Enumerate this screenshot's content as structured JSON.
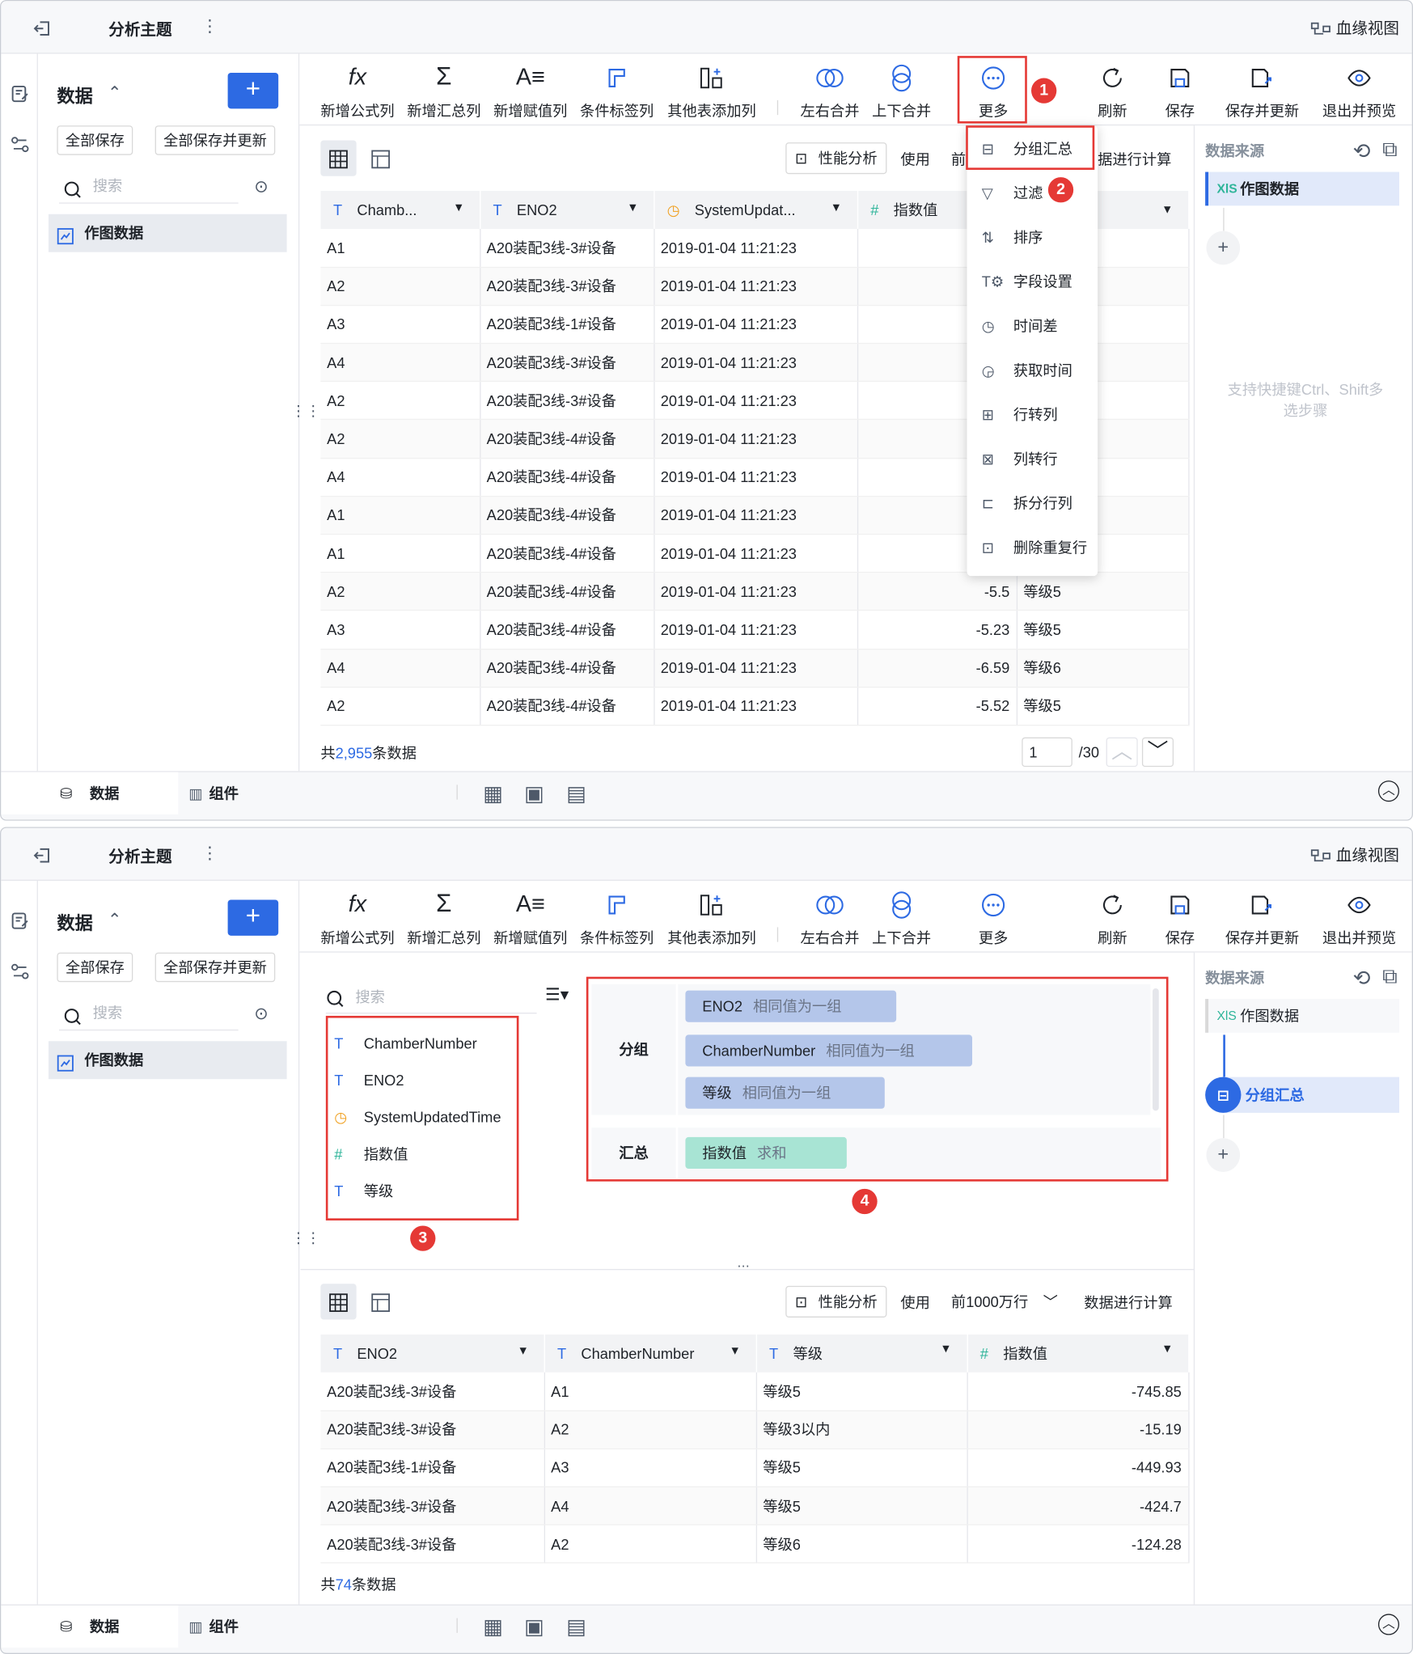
{
  "topbar": {
    "title": "分析主题",
    "lineage": "血缘视图"
  },
  "sidebar": {
    "title": "数据",
    "save_all": "全部保存",
    "save_all_update": "全部保存并更新",
    "search_placeholder": "搜索",
    "item": "作图数据"
  },
  "toolbar": {
    "items": [
      "新增公式列",
      "新增汇总列",
      "新增赋值列",
      "条件标签列",
      "其他表添加列",
      "左右合并",
      "上下合并",
      "更多",
      "刷新",
      "保存",
      "保存并更新",
      "退出并预览"
    ]
  },
  "panel1": {
    "perf": "性能分析",
    "use": "使用",
    "use_trunc": "前",
    "calc": "数据进行计算",
    "calc_trunc": "据进行计算",
    "columns": [
      "Chamb...",
      "ENO2",
      "SystemUpdat...",
      "指数值",
      ""
    ],
    "rows": [
      [
        "A1",
        "A20装配3线-3#设备",
        "2019-01-04 11:21:23",
        "",
        ""
      ],
      [
        "A2",
        "A20装配3线-3#设备",
        "2019-01-04 11:21:23",
        "",
        ""
      ],
      [
        "A3",
        "A20装配3线-1#设备",
        "2019-01-04 11:21:23",
        "",
        ""
      ],
      [
        "A4",
        "A20装配3线-3#设备",
        "2019-01-04 11:21:23",
        "",
        ""
      ],
      [
        "A2",
        "A20装配3线-3#设备",
        "2019-01-04 11:21:23",
        "",
        ""
      ],
      [
        "A2",
        "A20装配3线-4#设备",
        "2019-01-04 11:21:23",
        "",
        ""
      ],
      [
        "A4",
        "A20装配3线-4#设备",
        "2019-01-04 11:21:23",
        "",
        ""
      ],
      [
        "A1",
        "A20装配3线-4#设备",
        "2019-01-04 11:21:23",
        "",
        ""
      ],
      [
        "A1",
        "A20装配3线-4#设备",
        "2019-01-04 11:21:23",
        "",
        ""
      ],
      [
        "A2",
        "A20装配3线-4#设备",
        "2019-01-04 11:21:23",
        "-5.5",
        "等级5"
      ],
      [
        "A3",
        "A20装配3线-4#设备",
        "2019-01-04 11:21:23",
        "-5.23",
        "等级5"
      ],
      [
        "A4",
        "A20装配3线-4#设备",
        "2019-01-04 11:21:23",
        "-6.59",
        "等级6"
      ],
      [
        "A2",
        "A20装配3线-4#设备",
        "2019-01-04 11:21:23",
        "-5.52",
        "等级5"
      ]
    ],
    "total_prefix": "共",
    "total": "2,955",
    "total_suffix": "条数据",
    "page": "1",
    "pages": "/30",
    "datasource_title": "数据来源",
    "datasource_item": "作图数据",
    "hint": "支持快捷键Ctrl、Shift多选步骤"
  },
  "menu": {
    "items": [
      "分组汇总",
      "过滤",
      "排序",
      "字段设置",
      "时间差",
      "获取时间",
      "行转列",
      "列转行",
      "拆分行列",
      "删除重复行"
    ]
  },
  "badges": [
    "1",
    "2",
    "3",
    "4"
  ],
  "panel2": {
    "search_placeholder": "搜索",
    "fields": [
      "ChamberNumber",
      "ENO2",
      "SystemUpdatedTime",
      "指数值",
      "等级"
    ],
    "group_label": "分组",
    "summary_label": "汇总",
    "groups": [
      {
        "name": "ENO2",
        "mode": "相同值为一组"
      },
      {
        "name": "ChamberNumber",
        "mode": "相同值为一组"
      },
      {
        "name": "等级",
        "mode": "相同值为一组"
      }
    ],
    "summary": {
      "name": "指数值",
      "mode": "求和"
    },
    "perf": "性能分析",
    "use": "使用",
    "rows_limit": "前1000万行",
    "calc": "数据进行计算",
    "columns": [
      "ENO2",
      "ChamberNumber",
      "等级",
      "指数值"
    ],
    "rows": [
      [
        "A20装配3线-3#设备",
        "A1",
        "等级5",
        "-745.85"
      ],
      [
        "A20装配3线-3#设备",
        "A2",
        "等级3以内",
        "-15.19"
      ],
      [
        "A20装配3线-1#设备",
        "A3",
        "等级5",
        "-449.93"
      ],
      [
        "A20装配3线-3#设备",
        "A4",
        "等级5",
        "-424.7"
      ],
      [
        "A20装配3线-3#设备",
        "A2",
        "等级6",
        "-124.28"
      ]
    ],
    "total_prefix": "共",
    "total": "74",
    "total_suffix": "条数据",
    "datasource_title": "数据来源",
    "datasource_item": "作图数据",
    "step": "分组汇总"
  },
  "bottom": {
    "data_tab": "数据",
    "component_tab": "组件"
  },
  "colors": {
    "accent": "#2d6ae3",
    "highlight_red": "#e53935",
    "group_pill": "#b4c6ea",
    "summary_pill": "#a8e4d4"
  }
}
